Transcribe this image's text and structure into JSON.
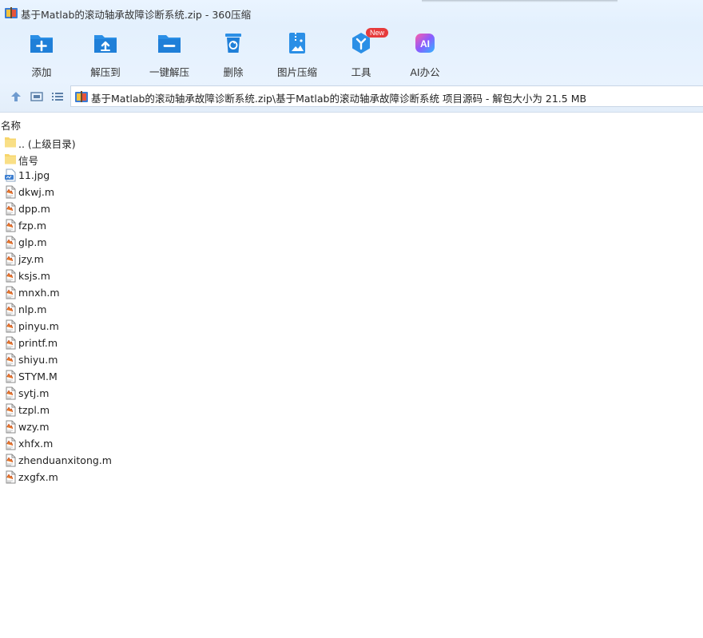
{
  "window": {
    "title": "基于Matlab的滚动轴承故障诊断系统.zip - 360压缩"
  },
  "toolbar": {
    "buttons": [
      {
        "label": "添加",
        "icon": "add-icon"
      },
      {
        "label": "解压到",
        "icon": "extract-to-icon"
      },
      {
        "label": "一键解压",
        "icon": "one-click-extract-icon"
      },
      {
        "label": "删除",
        "icon": "delete-icon"
      },
      {
        "label": "图片压缩",
        "icon": "image-compress-icon"
      },
      {
        "label": "工具",
        "icon": "tools-icon",
        "badge": "New"
      },
      {
        "label": "AI办公",
        "icon": "ai-office-icon",
        "icon_text": "AI"
      }
    ]
  },
  "navbar": {
    "path": "基于Matlab的滚动轴承故障诊断系统.zip\\基于Matlab的滚动轴承故障诊断系统 项目源码 - 解包大小为 21.5 MB"
  },
  "list": {
    "header": "名称",
    "items": [
      {
        "name": ".. (上级目录)",
        "type": "folder"
      },
      {
        "name": "信号",
        "type": "folder"
      },
      {
        "name": "11.jpg",
        "type": "jpg"
      },
      {
        "name": "dkwj.m",
        "type": "m"
      },
      {
        "name": "dpp.m",
        "type": "m"
      },
      {
        "name": "fzp.m",
        "type": "m"
      },
      {
        "name": "glp.m",
        "type": "m"
      },
      {
        "name": "jzy.m",
        "type": "m"
      },
      {
        "name": "ksjs.m",
        "type": "m"
      },
      {
        "name": "mnxh.m",
        "type": "m"
      },
      {
        "name": "nlp.m",
        "type": "m"
      },
      {
        "name": "pinyu.m",
        "type": "m"
      },
      {
        "name": "printf.m",
        "type": "m"
      },
      {
        "name": "shiyu.m",
        "type": "m"
      },
      {
        "name": "STYM.M",
        "type": "m"
      },
      {
        "name": "sytj.m",
        "type": "m"
      },
      {
        "name": "tzpl.m",
        "type": "m"
      },
      {
        "name": "wzy.m",
        "type": "m"
      },
      {
        "name": "xhfx.m",
        "type": "m"
      },
      {
        "name": "zhenduanxitong.m",
        "type": "m"
      },
      {
        "name": "zxgfx.m",
        "type": "m"
      }
    ]
  },
  "colors": {
    "accent": "#2b8fe6",
    "folder": "#f7d56b",
    "badge": "#e63b3b"
  }
}
